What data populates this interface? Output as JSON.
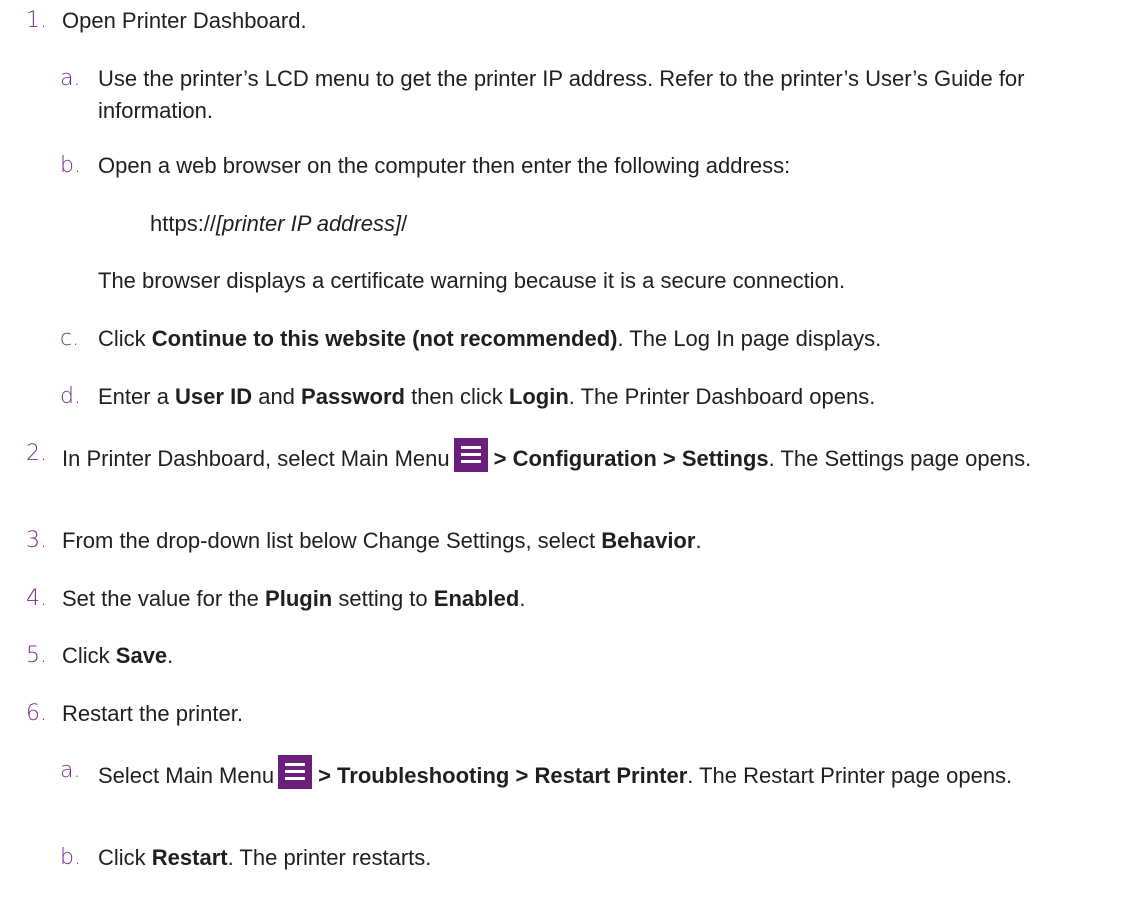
{
  "colors": {
    "marker": "#7a2a8e",
    "menu_icon_bg": "#6b1f7b",
    "text": "#1f1f1f"
  },
  "steps": [
    {
      "num": "1.",
      "text": "Open Printer Dashboard."
    },
    {
      "num": "a.",
      "text": "Use the printer’s LCD menu to get the printer IP address. Refer to the printer’s User’s Guide for information."
    },
    {
      "num": "b.",
      "text": "Open a web browser on the computer then enter the following address:"
    },
    {
      "url_prefix": "https://",
      "url_var": "[printer IP address]",
      "url_suffix": "/"
    },
    {
      "text": "The browser displays a certificate warning because it is a secure connection."
    },
    {
      "num": "c.",
      "pre": "Click ",
      "bold": "Continue to this website (not recommended)",
      "post": ". The Log In page displays."
    },
    {
      "num": "d.",
      "pre": "Enter a ",
      "b1": "User ID",
      "mid1": " and ",
      "b2": "Password",
      "mid2": " then click ",
      "b3": "Login",
      "post": ". The Printer Dashboard opens."
    },
    {
      "num": "2.",
      "pre": "In Printer Dashboard, select Main Menu",
      "icon": "menu-icon",
      "bold": "> Configuration > Settings",
      "post": ". The Settings page opens."
    },
    {
      "num": "3.",
      "pre": "From the drop-down list below Change Settings, select ",
      "bold": "Behavior",
      "post": "."
    },
    {
      "num": "4.",
      "pre": "Set the value for the ",
      "b1": "Plugin",
      "mid1": " setting to ",
      "b2": "Enabled",
      "post": "."
    },
    {
      "num": "5.",
      "pre": "Click ",
      "bold": "Save",
      "post": "."
    },
    {
      "num": "6.",
      "text": "Restart the printer."
    },
    {
      "num": "a.",
      "pre": "Select Main Menu",
      "icon": "menu-icon",
      "bold": "> Troubleshooting > Restart Printer",
      "post": ". The Restart Printer page opens."
    },
    {
      "num": "b.",
      "pre": "Click ",
      "bold": "Restart",
      "post": ". The printer restarts."
    }
  ]
}
